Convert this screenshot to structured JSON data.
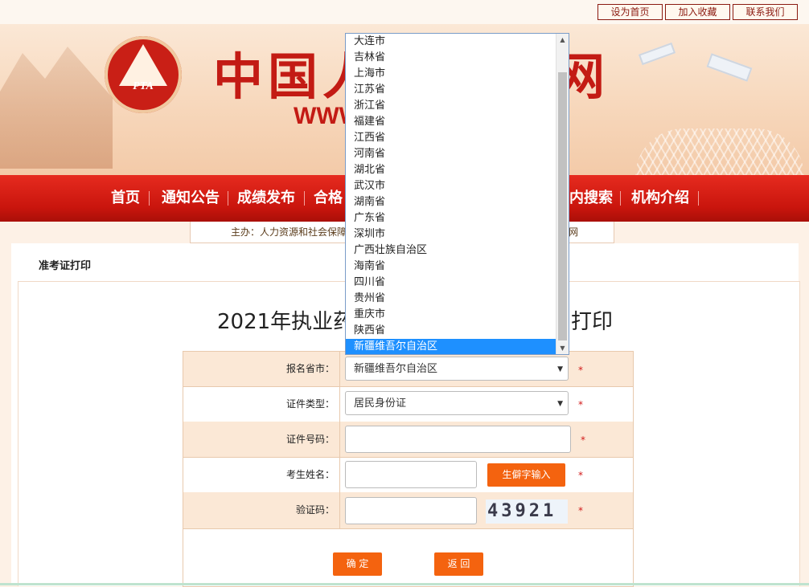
{
  "top_links": [
    "设为首页",
    "加入收藏",
    "联系我们"
  ],
  "banner": {
    "logo_text": "PTA",
    "title_left": "中国人",
    "title_right": "网",
    "url": "WWW"
  },
  "nav": {
    "items": [
      "首页",
      "通知公告",
      "成绩发布",
      "合格",
      "内搜索",
      "机构介绍"
    ]
  },
  "host": {
    "left": "主办：人力资源和社会保障",
    "right": "网"
  },
  "breadcrumb": "准考证打印",
  "page_title": {
    "left": "2021年执业药",
    "right": "打印"
  },
  "form": {
    "province_label": "报名省市：",
    "province_value": "新疆维吾尔自治区",
    "idtype_label": "证件类型：",
    "idtype_value": "居民身份证",
    "idnum_label": "证件号码：",
    "name_label": "考生姓名：",
    "rare_char_button": "生僻字输入",
    "captcha_label": "验证码：",
    "captcha_text": "43921",
    "required_mark": "*",
    "confirm_button": "确 定",
    "back_button": "返 回"
  },
  "dropdown_options": [
    "大连市",
    "吉林省",
    "上海市",
    "江苏省",
    "浙江省",
    "福建省",
    "江西省",
    "河南省",
    "湖北省",
    "武汉市",
    "湖南省",
    "广东省",
    "深圳市",
    "广西壮族自治区",
    "海南省",
    "四川省",
    "贵州省",
    "重庆市",
    "陕西省",
    "新疆维吾尔自治区"
  ],
  "dropdown_selected": "新疆维吾尔自治区",
  "colors": {
    "brand_red": "#c9150d",
    "button_orange": "#f4630f",
    "selected_blue": "#1e90ff"
  }
}
